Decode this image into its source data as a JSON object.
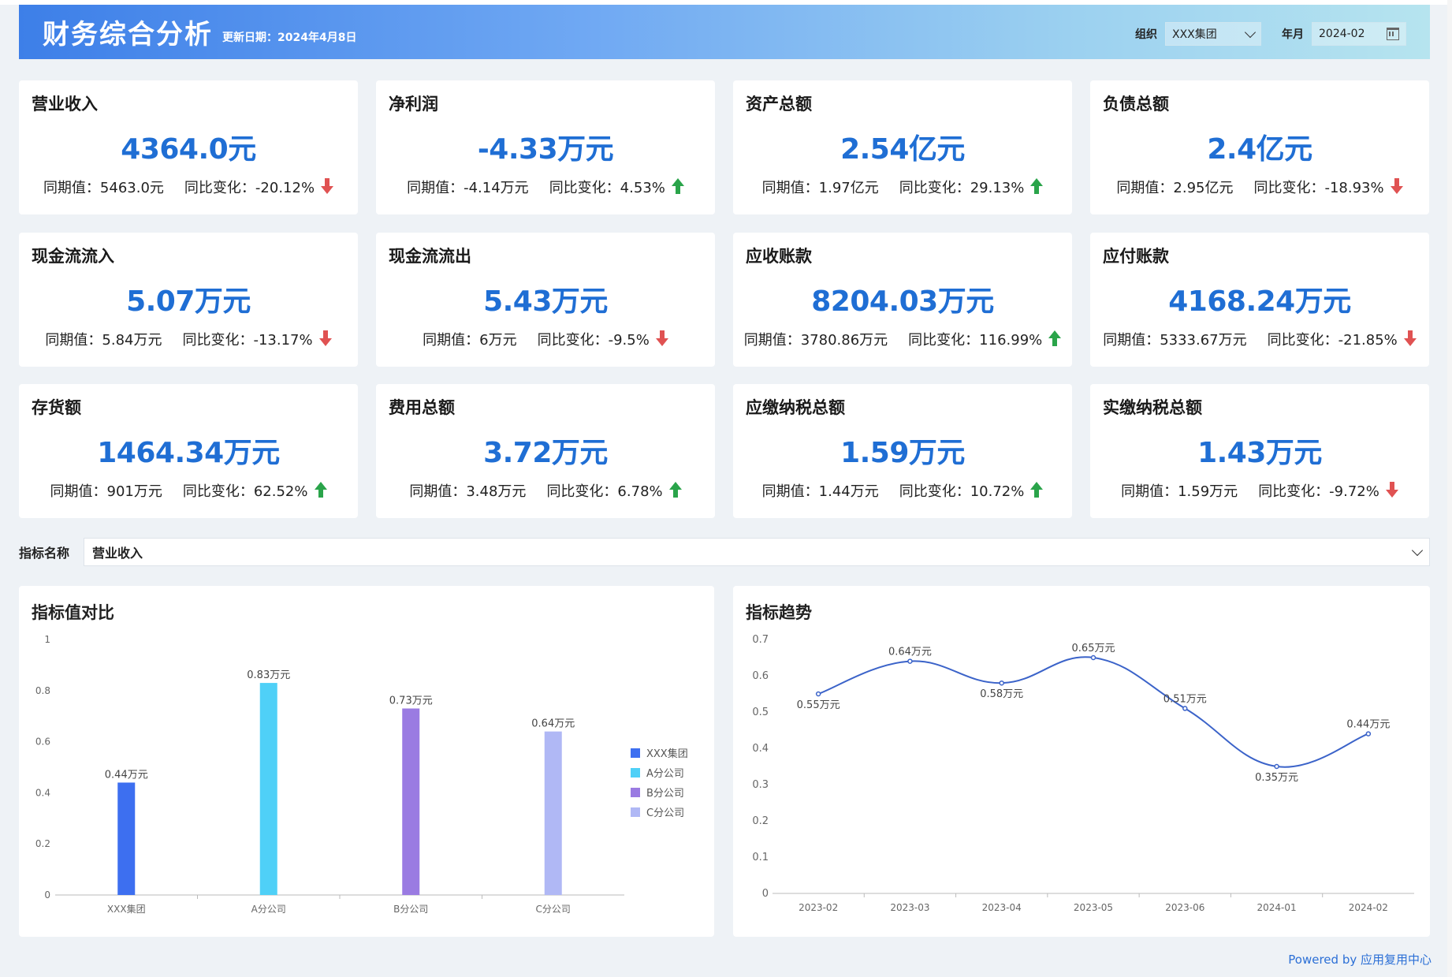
{
  "header": {
    "title": "财务综合分析",
    "update_text": "更新日期：2024年4月8日",
    "org_label": "组织",
    "org_value": "XXX集团",
    "month_label": "年月",
    "month_value": "2024-02"
  },
  "kpis": [
    {
      "name": "营业收入",
      "value": "4364.0元",
      "prev": "同期值：5463.0元",
      "change": "同比变化：-20.12%",
      "trend": "down"
    },
    {
      "name": "净利润",
      "value": "-4.33万元",
      "prev": "同期值：-4.14万元",
      "change": "同比变化：4.53%",
      "trend": "up"
    },
    {
      "name": "资产总额",
      "value": "2.54亿元",
      "prev": "同期值：1.97亿元",
      "change": "同比变化：29.13%",
      "trend": "up"
    },
    {
      "name": "负债总额",
      "value": "2.4亿元",
      "prev": "同期值：2.95亿元",
      "change": "同比变化：-18.93%",
      "trend": "down"
    },
    {
      "name": "现金流流入",
      "value": "5.07万元",
      "prev": "同期值：5.84万元",
      "change": "同比变化：-13.17%",
      "trend": "down"
    },
    {
      "name": "现金流流出",
      "value": "5.43万元",
      "prev": "同期值：6万元",
      "change": "同比变化：-9.5%",
      "trend": "down"
    },
    {
      "name": "应收账款",
      "value": "8204.03万元",
      "prev": "同期值：3780.86万元",
      "change": "同比变化：116.99%",
      "trend": "up"
    },
    {
      "name": "应付账款",
      "value": "4168.24万元",
      "prev": "同期值：5333.67万元",
      "change": "同比变化：-21.85%",
      "trend": "down"
    },
    {
      "name": "存货额",
      "value": "1464.34万元",
      "prev": "同期值：901万元",
      "change": "同比变化：62.52%",
      "trend": "up"
    },
    {
      "name": "费用总额",
      "value": "3.72万元",
      "prev": "同期值：3.48万元",
      "change": "同比变化：6.78%",
      "trend": "up"
    },
    {
      "name": "应缴纳税总额",
      "value": "1.59万元",
      "prev": "同期值：1.44万元",
      "change": "同比变化：10.72%",
      "trend": "up"
    },
    {
      "name": "实缴纳税总额",
      "value": "1.43万元",
      "prev": "同期值：1.59万元",
      "change": "同比变化：-9.72%",
      "trend": "down"
    }
  ],
  "selector": {
    "label": "指标名称",
    "value": "营业收入"
  },
  "bar_panel_title": "指标值对比",
  "line_panel_title": "指标趋势",
  "footer": {
    "powered": "Powered by 应用复用中心"
  },
  "chart_data": [
    {
      "type": "bar",
      "title": "指标值对比",
      "categories": [
        "XXX集团",
        "A分公司",
        "B分公司",
        "C分公司"
      ],
      "values": [
        0.44,
        0.83,
        0.73,
        0.64
      ],
      "data_labels": [
        "0.44万元",
        "0.83万元",
        "0.73万元",
        "0.64万元"
      ],
      "colors": [
        "#3d6ff0",
        "#4fd0f7",
        "#9a7be2",
        "#b0b8f5"
      ],
      "legend": [
        "XXX集团",
        "A分公司",
        "B分公司",
        "C分公司"
      ],
      "legend_position": "right",
      "ylim": [
        0,
        1
      ],
      "yticks": [
        "0",
        "0.2",
        "0.4",
        "0.6",
        "0.8",
        "1"
      ],
      "grid": false
    },
    {
      "type": "line",
      "title": "指标趋势",
      "categories": [
        "2023-02",
        "2023-03",
        "2023-04",
        "2023-05",
        "2023-06",
        "2024-01",
        "2024-02"
      ],
      "values": [
        0.55,
        0.64,
        0.58,
        0.65,
        0.51,
        0.35,
        0.44
      ],
      "data_labels": [
        "0.55万元",
        "0.64万元",
        "0.58万元",
        "0.65万元",
        "0.51万元",
        "0.35万元",
        "0.44万元"
      ],
      "color": "#3b63c9",
      "ylim": [
        0,
        0.7
      ],
      "yticks": [
        "0",
        "0.1",
        "0.2",
        "0.3",
        "0.4",
        "0.5",
        "0.6",
        "0.7"
      ],
      "smooth": true,
      "grid": false
    }
  ]
}
